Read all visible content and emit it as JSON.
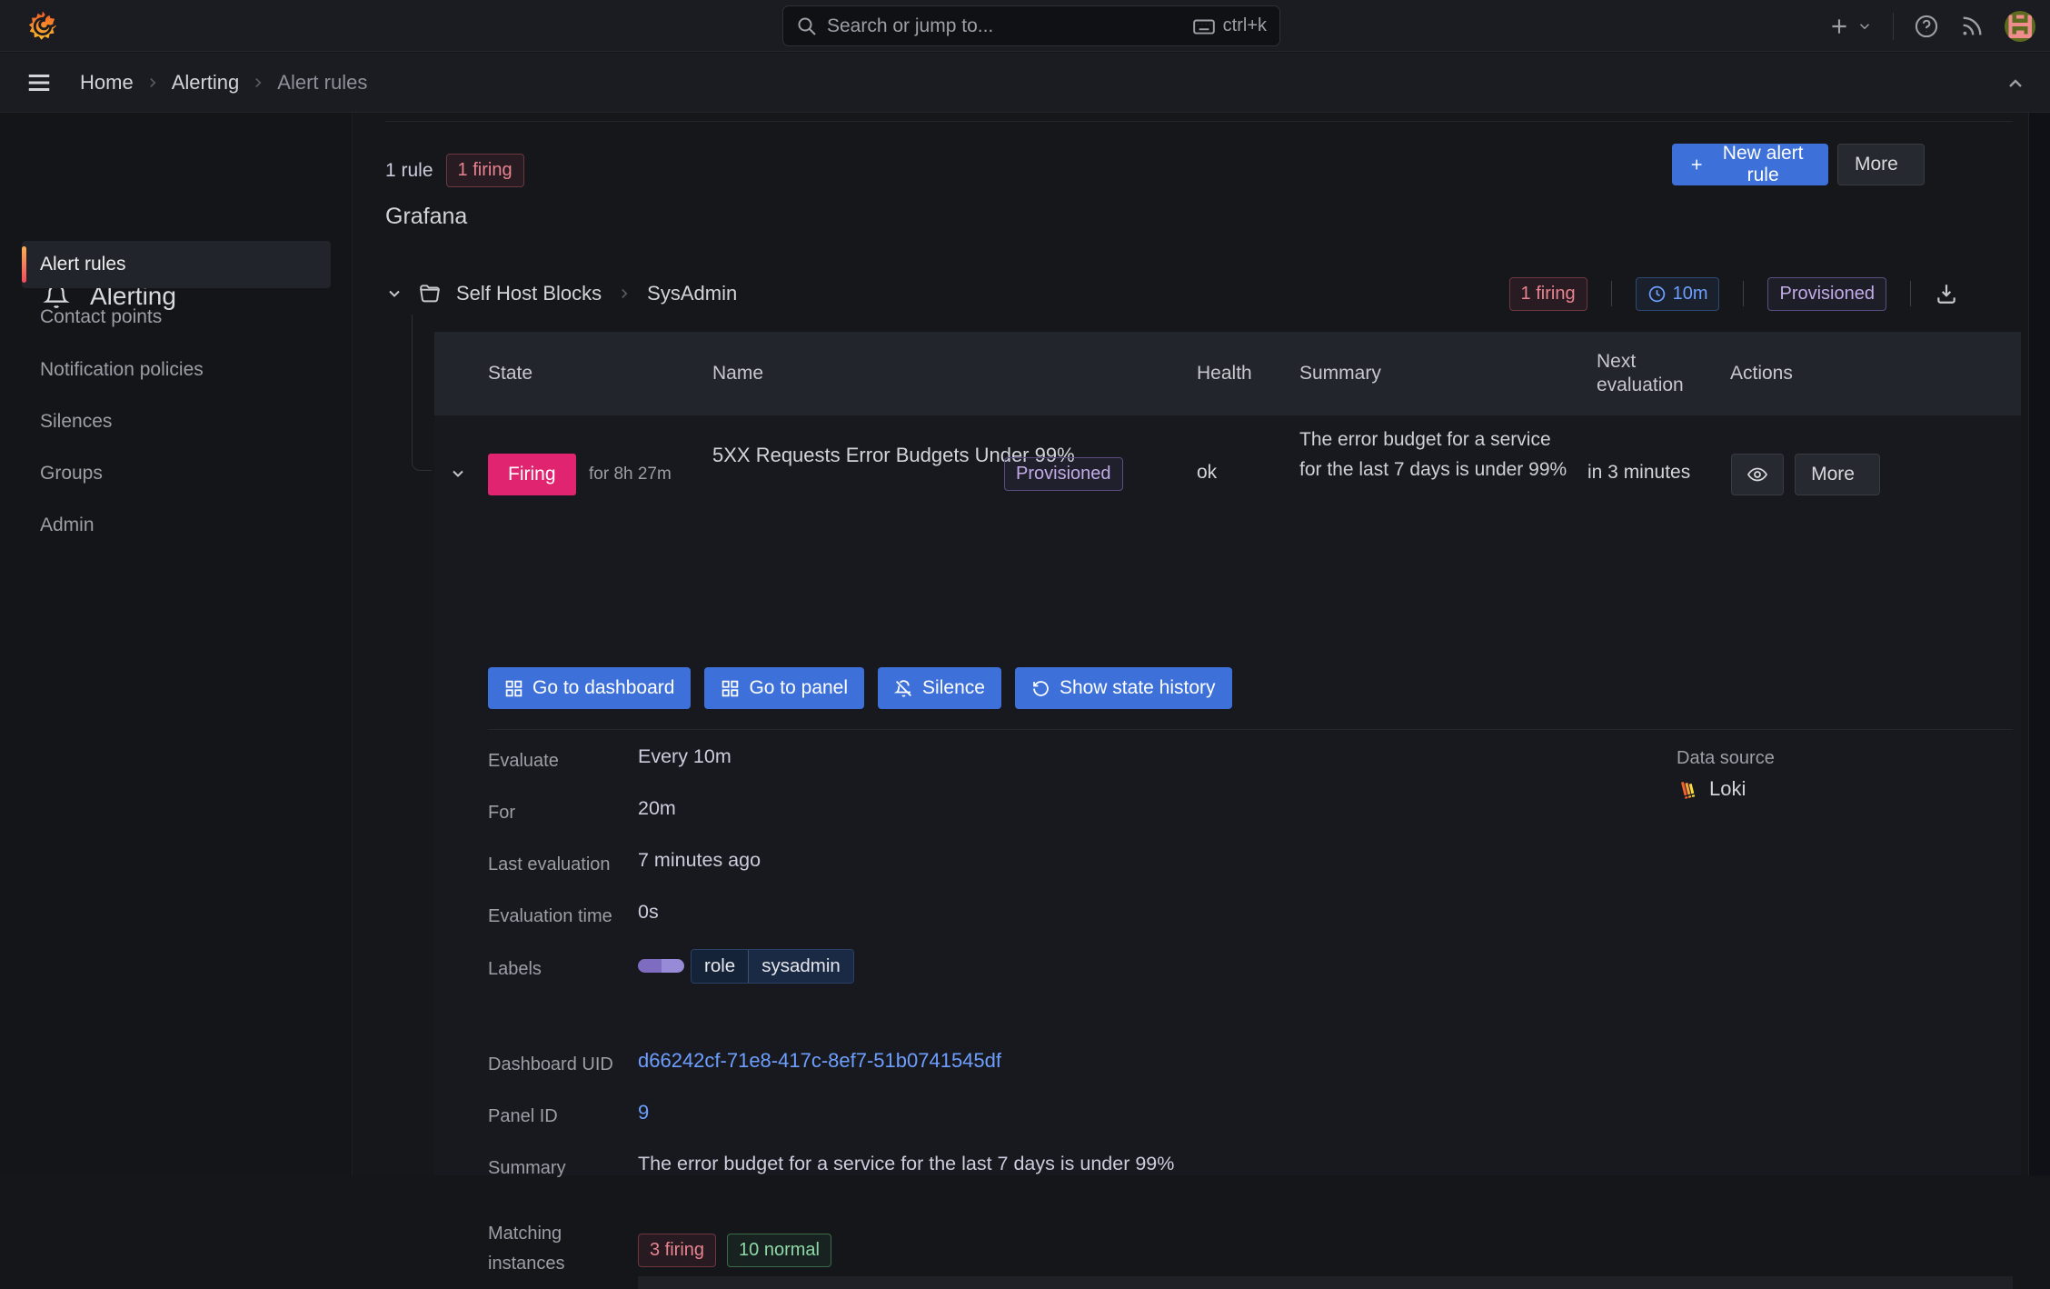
{
  "topbar": {
    "search": {
      "placeholder": "Search or jump to...",
      "shortcut": "ctrl+k"
    }
  },
  "breadcrumb": {
    "items": [
      "Home",
      "Alerting",
      "Alert rules"
    ]
  },
  "sidebar": {
    "title": "Alerting",
    "items": [
      {
        "label": "Alert rules"
      },
      {
        "label": "Contact points"
      },
      {
        "label": "Notification policies"
      },
      {
        "label": "Silences"
      },
      {
        "label": "Groups"
      },
      {
        "label": "Admin"
      }
    ]
  },
  "header": {
    "rule_count": "1 rule",
    "firing_badge": "1 firing",
    "new_alert_rule_label": "New alert rule",
    "more_label": "More"
  },
  "group": {
    "section_label": "Grafana",
    "folder": "Self Host Blocks",
    "subfolder": "SysAdmin",
    "firing_badge": "1 firing",
    "interval": "10m",
    "provisioned_label": "Provisioned"
  },
  "table": {
    "columns": [
      "State",
      "Name",
      "Health",
      "Summary",
      "Next evaluation",
      "Actions"
    ],
    "row": {
      "state": "Firing",
      "state_duration": "for 8h 27m",
      "name": "5XX Requests Error Budgets Under 99%",
      "provisioned_label": "Provisioned",
      "health": "ok",
      "summary": "The error budget for a service for the last 7 days is under 99%",
      "next_evaluation": "in 3 minutes",
      "more_label": "More"
    }
  },
  "actions": {
    "go_to_dashboard": "Go to dashboard",
    "go_to_panel": "Go to panel",
    "silence": "Silence",
    "show_state_history": "Show state history"
  },
  "details": {
    "evaluate": {
      "label": "Evaluate",
      "value": "Every 10m"
    },
    "for": {
      "label": "For",
      "value": "20m"
    },
    "last_evaluation": {
      "label": "Last evaluation",
      "value": "7 minutes ago"
    },
    "evaluation_time": {
      "label": "Evaluation time",
      "value": "0s"
    },
    "labels": {
      "label": "Labels",
      "key": "role",
      "value": "sysadmin"
    },
    "data_source": {
      "label": "Data source",
      "value": "Loki"
    },
    "dashboard_uid": {
      "label": "Dashboard UID",
      "value": "d66242cf-71e8-417c-8ef7-51b0741545df"
    },
    "panel_id": {
      "label": "Panel ID",
      "value": "9"
    },
    "summary": {
      "label": "Summary",
      "value": "The error budget for a service for the last 7 days is under 99%"
    },
    "matching_instances": {
      "label": "Matching instances",
      "firing": "3 firing",
      "normal": "10 normal"
    }
  },
  "colors": {
    "primary_button": "#3d71d9",
    "firing_state": "#e0246f",
    "firing_badge_text": "#e8838f",
    "normal_badge_text": "#8fd9a8",
    "provisioned_text": "#c3abe8",
    "interval_text": "#6e9fff",
    "link": "#6e9fff",
    "sidebar_accent": "#f2495c"
  }
}
